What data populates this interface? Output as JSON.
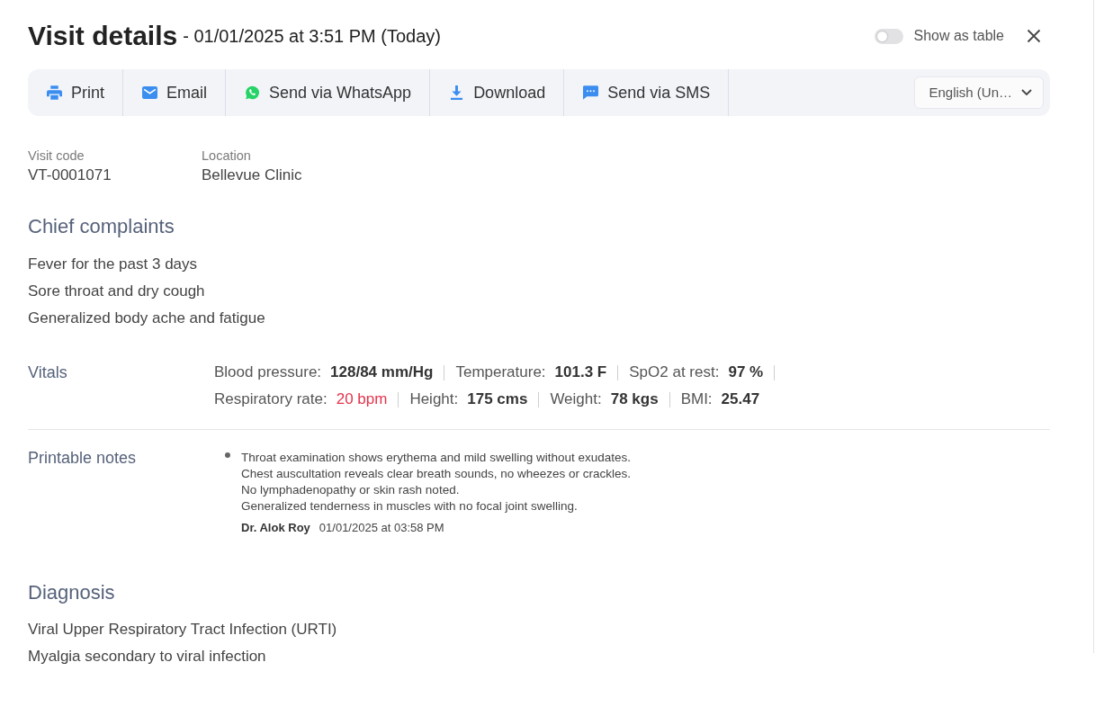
{
  "header": {
    "title": "Visit details",
    "subtitle": "- 01/01/2025 at 3:51 PM (Today)",
    "table_toggle": {
      "label": "Show as table",
      "on": false
    }
  },
  "toolbar": {
    "actions": [
      {
        "kind": "print",
        "label": "Print"
      },
      {
        "kind": "email",
        "label": "Email"
      },
      {
        "kind": "whatsapp",
        "label": "Send via WhatsApp"
      },
      {
        "kind": "download",
        "label": "Download"
      },
      {
        "kind": "sms",
        "label": "Send via SMS"
      }
    ],
    "language": {
      "value": "English (Un…"
    }
  },
  "visit_info": [
    {
      "label": "Visit code",
      "value": "VT-0001071"
    },
    {
      "label": "Location",
      "value": "Bellevue Clinic"
    }
  ],
  "chief_complaints": {
    "heading": "Chief complaints",
    "items": [
      "Fever for the past 3 days",
      "Sore throat and dry cough",
      "Generalized body ache and fatigue"
    ]
  },
  "vitals": {
    "heading": "Vitals",
    "rows": [
      [
        {
          "label": "Blood pressure:",
          "value": "128/84 mm/Hg",
          "abnormal": false
        },
        {
          "label": "Temperature:",
          "value": "101.3 F",
          "abnormal": false
        },
        {
          "label": "SpO2 at rest:",
          "value": "97 %",
          "abnormal": false
        }
      ],
      [
        {
          "label": "Respiratory rate:",
          "value": "20 bpm",
          "abnormal": true
        },
        {
          "label": "Height:",
          "value": "175 cms",
          "abnormal": false
        },
        {
          "label": "Weight:",
          "value": "78 kgs",
          "abnormal": false
        },
        {
          "label": "BMI:",
          "value": "25.47",
          "abnormal": false
        }
      ]
    ]
  },
  "printable_notes": {
    "heading": "Printable notes",
    "entries": [
      {
        "lines": [
          "Throat examination shows erythema and mild swelling without exudates.",
          "Chest auscultation reveals clear breath sounds, no wheezes or crackles.",
          "No lymphadenopathy or skin rash noted.",
          "Generalized tenderness in muscles with no focal joint swelling."
        ],
        "author": "Dr. Alok Roy",
        "time": "01/01/2025 at 03:58 PM"
      }
    ]
  },
  "diagnosis": {
    "heading": "Diagnosis",
    "items": [
      "Viral Upper Respiratory Tract Infection (URTI)",
      "Myalgia secondary to viral infection"
    ]
  }
}
